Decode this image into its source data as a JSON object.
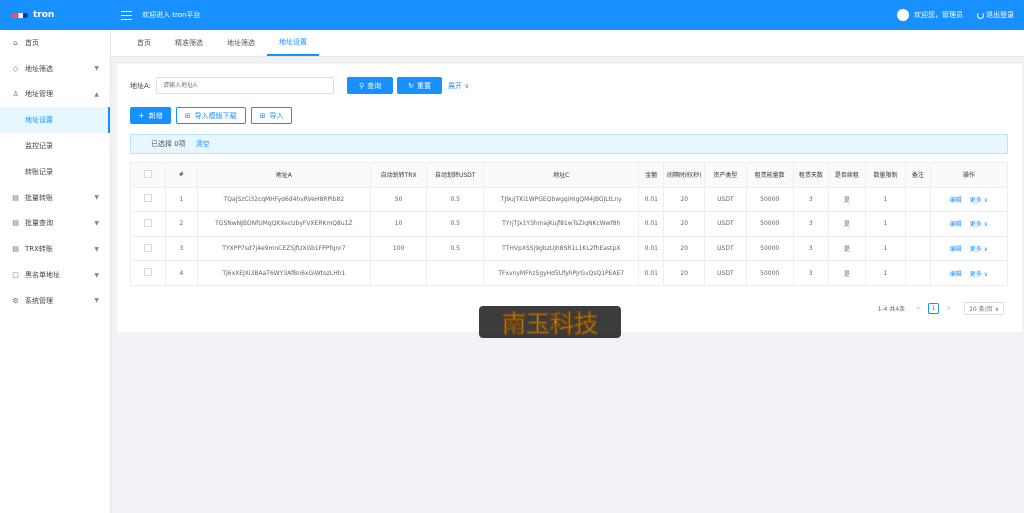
{
  "header": {
    "brand": "tron",
    "welcome": "欢迎进入 tron平台",
    "greeting": "欢迎您，管理员",
    "logout": "退出登录",
    "color": "#1890ff"
  },
  "sidebar": {
    "items": [
      {
        "label": "首页",
        "icon": "home-icon",
        "arrow": ""
      },
      {
        "label": "地址筛选",
        "icon": "tag-icon",
        "arrow": "▼"
      },
      {
        "label": "地址管理",
        "icon": "user-icon",
        "arrow": "▲"
      },
      {
        "label": "地址设置",
        "sub": true,
        "active": true
      },
      {
        "label": "监控记录",
        "sub": true
      },
      {
        "label": "转账记录",
        "sub": true
      },
      {
        "label": "批量转账",
        "icon": "list-icon",
        "arrow": "▼"
      },
      {
        "label": "批量查询",
        "icon": "list-icon",
        "arrow": "▼"
      },
      {
        "label": "TRX转账",
        "icon": "list-icon",
        "arrow": "▼"
      },
      {
        "label": "黑名单地址",
        "icon": "square-icon",
        "arrow": "▼"
      },
      {
        "label": "系统管理",
        "icon": "gear-icon",
        "arrow": "▼"
      }
    ]
  },
  "tabs": [
    "首页",
    "精准筛选",
    "地址筛选",
    "地址设置"
  ],
  "search": {
    "label": "地址A:",
    "placeholder": "请输入地址A",
    "query_label": "查询",
    "reset_label": "重置",
    "expand_label": "展开"
  },
  "actions": {
    "add": "新增",
    "download_template": "导入模版下载",
    "import": "导入"
  },
  "selection": {
    "selected": "已选择 0项",
    "clear": "清空"
  },
  "table": {
    "columns": [
      "#",
      "地址A",
      "自动划转TRX",
      "自动划转USDT",
      "地址C",
      "金额",
      "间隔时间(秒)",
      "资产类型",
      "租赁能量数",
      "租赁天数",
      "是否续租",
      "数量限制",
      "备注",
      "操作"
    ],
    "rows": [
      [
        "1",
        "TQaJSzCi32cqMHFyd6d4hvRVeH8RPib82",
        "50",
        "0.5",
        "TJ9uJTKi1WPGEQbwgqiHigQM4JBGJLtLny",
        "0.01",
        "20",
        "USDT",
        "50000",
        "3",
        "是",
        "1",
        ""
      ],
      [
        "2",
        "TGSNwNJBDNfUMqQKXecUbyFVXERKmQ8u1Z",
        "10",
        "0.5",
        "TYrjTJx1Y3hmajKujf81wTsZiqNKcWwf8h",
        "0.01",
        "20",
        "USDT",
        "50000",
        "3",
        "是",
        "1",
        ""
      ],
      [
        "3",
        "TYXPP7sd7j4e9mnCEZSJfUXGb1FPPfqnr7",
        "100",
        "0.5",
        "TTHVpXSSj9gbzUjh8SR1L1KL2fhEastpX",
        "0.01",
        "20",
        "USDT",
        "50000",
        "3",
        "是",
        "1",
        ""
      ],
      [
        "4",
        "TJ6xXEJXi3BAaT6WY3AfBn6xGiWtozLHh1",
        "",
        "",
        "TFxvnyMFhz5gyHd5UfyhPJrGvQsQ1PEAE7",
        "0.01",
        "20",
        "USDT",
        "50000",
        "3",
        "是",
        "1",
        ""
      ]
    ],
    "edit_label": "编辑",
    "more_label": "更多"
  },
  "pagination": {
    "summary": "1-4 共4条",
    "current": "1",
    "page_size": "10 条/页"
  },
  "watermark": {
    "text": "南玉科技"
  }
}
